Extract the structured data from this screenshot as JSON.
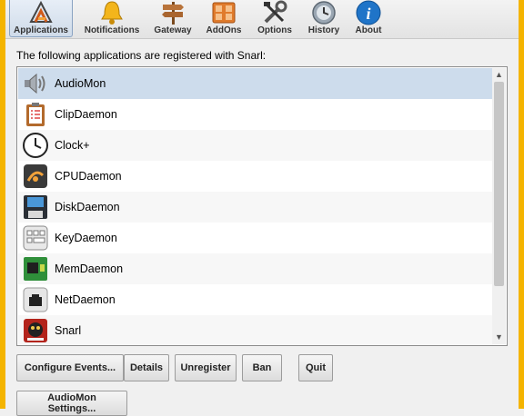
{
  "toolbar": {
    "tabs": [
      {
        "label": "Applications",
        "icon": "applications-icon",
        "active": true
      },
      {
        "label": "Notifications",
        "icon": "bell-icon",
        "active": false
      },
      {
        "label": "Gateway",
        "icon": "signpost-icon",
        "active": false
      },
      {
        "label": "AddOns",
        "icon": "addons-icon",
        "active": false
      },
      {
        "label": "Options",
        "icon": "tools-icon",
        "active": false
      },
      {
        "label": "History",
        "icon": "history-icon",
        "active": false
      },
      {
        "label": "About",
        "icon": "info-icon",
        "active": false
      }
    ]
  },
  "main": {
    "intro": "The following applications are registered with Snarl:",
    "apps": [
      {
        "name": "AudioMon",
        "icon": "speaker-icon",
        "selected": true
      },
      {
        "name": "ClipDaemon",
        "icon": "clipboard-icon"
      },
      {
        "name": "Clock+",
        "icon": "clock-icon"
      },
      {
        "name": "CPUDaemon",
        "icon": "cpu-icon"
      },
      {
        "name": "DiskDaemon",
        "icon": "disk-icon"
      },
      {
        "name": "KeyDaemon",
        "icon": "keyboard-icon"
      },
      {
        "name": "MemDaemon",
        "icon": "memory-icon"
      },
      {
        "name": "NetDaemon",
        "icon": "network-icon"
      },
      {
        "name": "Snarl",
        "icon": "snarl-icon"
      }
    ],
    "buttons": {
      "configure": "Configure Events...",
      "details": "Details",
      "unregister": "Unregister",
      "ban": "Ban",
      "quit": "Quit",
      "settings": "AudioMon Settings..."
    }
  },
  "colors": {
    "window_border": "#f4b400",
    "selection": "#cddcec",
    "accent": "#1f74c8"
  }
}
